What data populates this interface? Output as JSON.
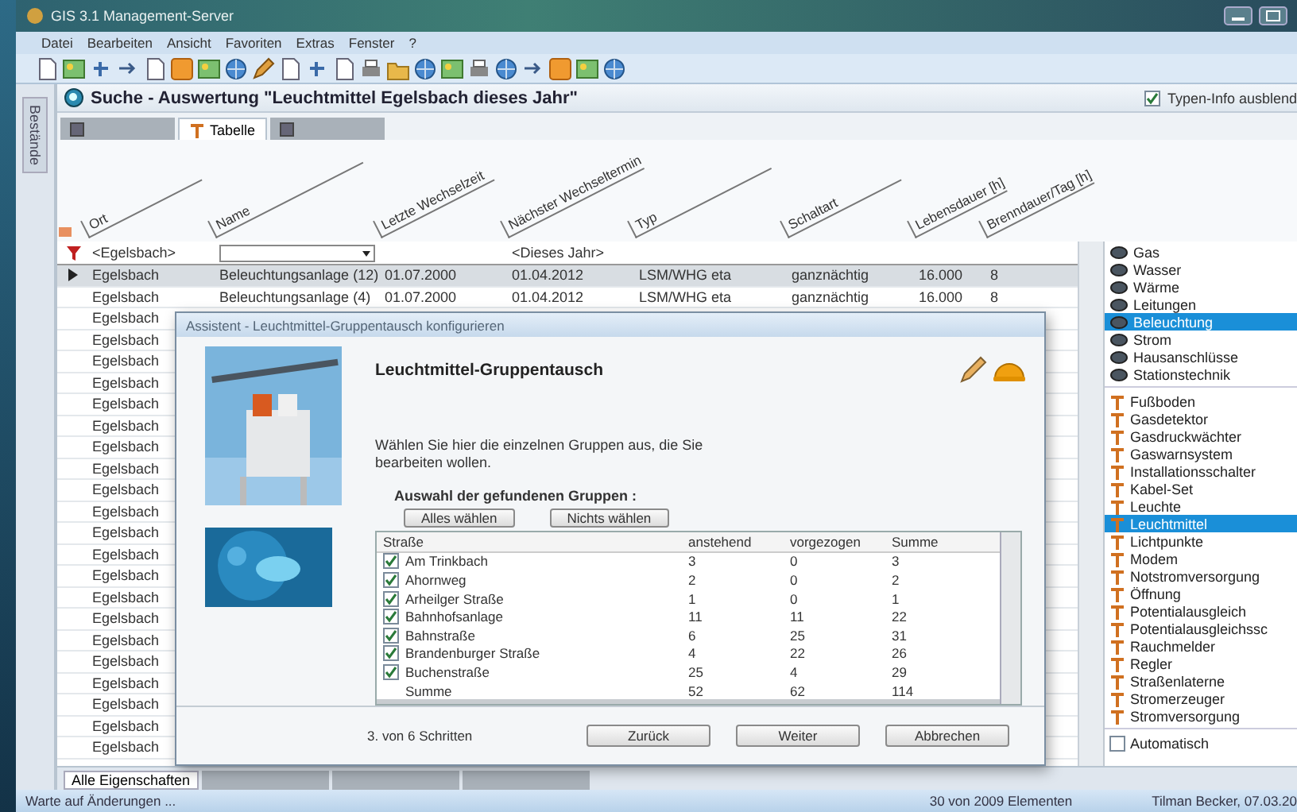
{
  "window": {
    "title": "GIS 3.1 Management-Server"
  },
  "menu": [
    "Datei",
    "Bearbeiten",
    "Ansicht",
    "Favoriten",
    "Extras",
    "Fenster",
    "?"
  ],
  "side_tab": {
    "label": "Bestände"
  },
  "heading": {
    "title": "Suche - Auswertung \"Leuchtmittel Egelsbach dieses Jahr\"",
    "type_info": {
      "label": "Typen-Info ausblend",
      "checked": true
    }
  },
  "view_tabs": [
    {
      "selected": false
    },
    {
      "label": "Tabelle",
      "selected": true
    },
    {
      "selected": false
    }
  ],
  "table": {
    "columns": [
      "Ort",
      "Name",
      "Letzte Wechselzeit",
      "Nächster Wechseltermin",
      "Typ",
      "Schaltart",
      "Lebensdauer [h]",
      "Brenndauer/Tag [h]"
    ],
    "filter": [
      {
        "kind": "text",
        "value": "<Egelsbach>"
      },
      {
        "kind": "dropdown"
      },
      {
        "kind": "blank"
      },
      {
        "kind": "text",
        "value": "<Dieses Jahr>"
      }
    ],
    "rows": [
      {
        "cells": [
          "Egelsbach",
          "Beleuchtungsanlage (12)",
          "01.07.2000",
          "01.04.2012",
          "LSM/WHG eta",
          "ganznächtig",
          "16.000",
          "8"
        ],
        "selected": true
      },
      {
        "cells": [
          "Egelsbach",
          "Beleuchtungsanlage (4)",
          "01.07.2000",
          "01.04.2012",
          "LSM/WHG eta",
          "ganznächtig",
          "16.000",
          "8"
        ],
        "selected": false
      },
      {
        "cells": [
          "Egelsbach"
        ],
        "selected": false
      },
      {
        "cells": [
          "Egelsbach"
        ],
        "selected": false
      },
      {
        "cells": [
          "Egelsbach"
        ],
        "selected": false
      },
      {
        "cells": [
          "Egelsbach"
        ],
        "selected": false
      },
      {
        "cells": [
          "Egelsbach"
        ],
        "selected": false
      },
      {
        "cells": [
          "Egelsbach"
        ],
        "selected": false
      },
      {
        "cells": [
          "Egelsbach"
        ],
        "selected": false
      },
      {
        "cells": [
          "Egelsbach"
        ],
        "selected": false
      },
      {
        "cells": [
          "Egelsbach"
        ],
        "selected": false
      },
      {
        "cells": [
          "Egelsbach"
        ],
        "selected": false
      },
      {
        "cells": [
          "Egelsbach"
        ],
        "selected": false
      },
      {
        "cells": [
          "Egelsbach"
        ],
        "selected": false
      },
      {
        "cells": [
          "Egelsbach"
        ],
        "selected": false
      },
      {
        "cells": [
          "Egelsbach"
        ],
        "selected": false
      },
      {
        "cells": [
          "Egelsbach"
        ],
        "selected": false
      },
      {
        "cells": [
          "Egelsbach"
        ],
        "selected": false
      },
      {
        "cells": [
          "Egelsbach"
        ],
        "selected": false
      },
      {
        "cells": [
          "Egelsbach"
        ],
        "selected": false
      },
      {
        "cells": [
          "Egelsbach"
        ],
        "selected": false
      },
      {
        "cells": [
          "Egelsbach"
        ],
        "selected": false
      },
      {
        "cells": [
          "Egelsbach"
        ],
        "selected": false
      }
    ]
  },
  "layers": {
    "items": [
      {
        "kind": "layer",
        "label": "Gas",
        "selected": false
      },
      {
        "kind": "layer",
        "label": "Wasser",
        "selected": false
      },
      {
        "kind": "layer",
        "label": "Wärme",
        "selected": false
      },
      {
        "kind": "layer",
        "label": "Leitungen",
        "selected": false
      },
      {
        "kind": "layer",
        "label": "Beleuchtung",
        "selected": true
      },
      {
        "kind": "layer",
        "label": "Strom",
        "selected": false
      },
      {
        "kind": "layer",
        "label": "Hausanschlüsse",
        "selected": false
      },
      {
        "kind": "layer",
        "label": "Stationstechnik",
        "selected": false
      },
      {
        "kind": "type",
        "label": "Fußboden",
        "selected": false
      },
      {
        "kind": "type",
        "label": "Gasdetektor",
        "selected": false
      },
      {
        "kind": "type",
        "label": "Gasdruckwächter",
        "selected": false
      },
      {
        "kind": "type",
        "label": "Gaswarnsystem",
        "selected": false
      },
      {
        "kind": "type",
        "label": "Installationsschalter",
        "selected": false
      },
      {
        "kind": "type",
        "label": "Kabel-Set",
        "selected": false
      },
      {
        "kind": "type",
        "label": "Leuchte",
        "selected": false
      },
      {
        "kind": "type",
        "label": "Leuchtmittel",
        "selected": true
      },
      {
        "kind": "type",
        "label": "Lichtpunkte",
        "selected": false
      },
      {
        "kind": "type",
        "label": "Modem",
        "selected": false
      },
      {
        "kind": "type",
        "label": "Notstromversorgung",
        "selected": false
      },
      {
        "kind": "type",
        "label": "Öffnung",
        "selected": false
      },
      {
        "kind": "type",
        "label": "Potentialausgleich",
        "selected": false
      },
      {
        "kind": "type",
        "label": "Potentialausgleichssc",
        "selected": false
      },
      {
        "kind": "type",
        "label": "Rauchmelder",
        "selected": false
      },
      {
        "kind": "type",
        "label": "Regler",
        "selected": false
      },
      {
        "kind": "type",
        "label": "Straßenlaterne",
        "selected": false
      },
      {
        "kind": "type",
        "label": "Stromerzeuger",
        "selected": false
      },
      {
        "kind": "type",
        "label": "Stromversorgung",
        "selected": false
      }
    ],
    "auto": {
      "label": "Automatisch",
      "checked": false
    }
  },
  "dialog": {
    "title": "Assistent - Leuchtmittel-Gruppentausch konfigurieren",
    "heading": "Leuchtmittel-Gruppentausch",
    "text": "Wählen Sie hier die einzelnen Gruppen aus, die Sie bearbeiten wollen.",
    "group_label": "Auswahl der gefundenen Gruppen :",
    "select_buttons": [
      "Alles wählen",
      "Nichts wählen"
    ],
    "groups": {
      "columns": [
        "Straße",
        "anstehend",
        "vorgezogen",
        "Summe"
      ],
      "rows": [
        {
          "kind": "group",
          "checked": true,
          "cells": [
            "Am Trinkbach",
            "3",
            "0",
            "3"
          ]
        },
        {
          "kind": "group",
          "checked": true,
          "cells": [
            "Ahornweg",
            "2",
            "0",
            "2"
          ]
        },
        {
          "kind": "group",
          "checked": true,
          "cells": [
            "Arheilger Straße",
            "1",
            "0",
            "1"
          ]
        },
        {
          "kind": "group",
          "checked": true,
          "cells": [
            "Bahnhofsanlage",
            "11",
            "11",
            "22"
          ]
        },
        {
          "kind": "group",
          "checked": true,
          "cells": [
            "Bahnstraße",
            "6",
            "25",
            "31"
          ]
        },
        {
          "kind": "group",
          "checked": true,
          "cells": [
            "Brandenburger Straße",
            "4",
            "22",
            "26"
          ]
        },
        {
          "kind": "group",
          "checked": true,
          "cells": [
            "Buchenstraße",
            "25",
            "4",
            "29"
          ]
        },
        {
          "kind": "total",
          "cells": [
            "Summe",
            "52",
            "62",
            "114"
          ]
        }
      ]
    },
    "step": "3. von 6 Schritten",
    "buttons": [
      "Zurück",
      "Weiter",
      "Abbrechen"
    ]
  },
  "bottom_tabs": [
    {
      "label": "Alle Eigenschaften",
      "selected": true
    },
    {
      "selected": false
    },
    {
      "selected": false
    },
    {
      "selected": false
    }
  ],
  "status_bar": {
    "message": "Warte auf Änderungen ...",
    "count": "30 von 2009 Elementen",
    "user": "Tilman Becker, 07.03.20"
  }
}
